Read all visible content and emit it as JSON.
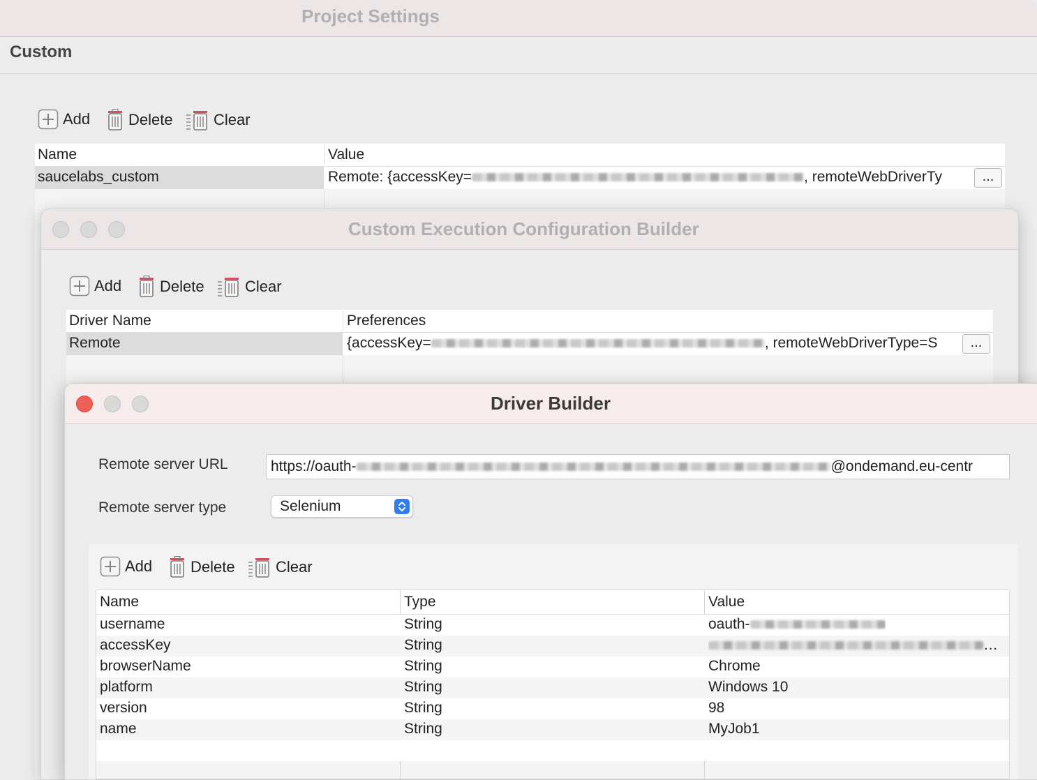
{
  "project": {
    "title": "Project Settings",
    "section": "Custom",
    "toolbar": {
      "add": "Add",
      "delete": "Delete",
      "clear": "Clear"
    },
    "table": {
      "headers": [
        "Name",
        "Value"
      ],
      "row": {
        "name": "saucelabs_custom",
        "value_prefix": "Remote: {accessKey=",
        "value_suffix": ", remoteWebDriverTy"
      }
    },
    "ellipsis": "..."
  },
  "ceb": {
    "title": "Custom Execution Configuration Builder",
    "toolbar": {
      "add": "Add",
      "delete": "Delete",
      "clear": "Clear"
    },
    "table": {
      "headers": [
        "Driver Name",
        "Preferences"
      ],
      "row": {
        "name": "Remote",
        "pref_prefix": "{accessKey=",
        "pref_suffix": ", remoteWebDriverType=S"
      }
    },
    "ellipsis": "..."
  },
  "driver": {
    "title": "Driver Builder",
    "url_label": "Remote server URL",
    "url_prefix": "https://oauth-",
    "url_suffix": "@ondemand.eu-centr",
    "type_label": "Remote server type",
    "type_value": "Selenium",
    "toolbar": {
      "add": "Add",
      "delete": "Delete",
      "clear": "Clear"
    },
    "table": {
      "headers": [
        "Name",
        "Type",
        "Value"
      ],
      "rows": [
        {
          "name": "username",
          "type": "String",
          "value": "oauth-"
        },
        {
          "name": "accessKey",
          "type": "String",
          "value": "…"
        },
        {
          "name": "browserName",
          "type": "String",
          "value": "Chrome"
        },
        {
          "name": "platform",
          "type": "String",
          "value": "Windows 10"
        },
        {
          "name": "version",
          "type": "String",
          "value": "98"
        },
        {
          "name": "name",
          "type": "String",
          "value": "MyJob1"
        }
      ]
    }
  }
}
